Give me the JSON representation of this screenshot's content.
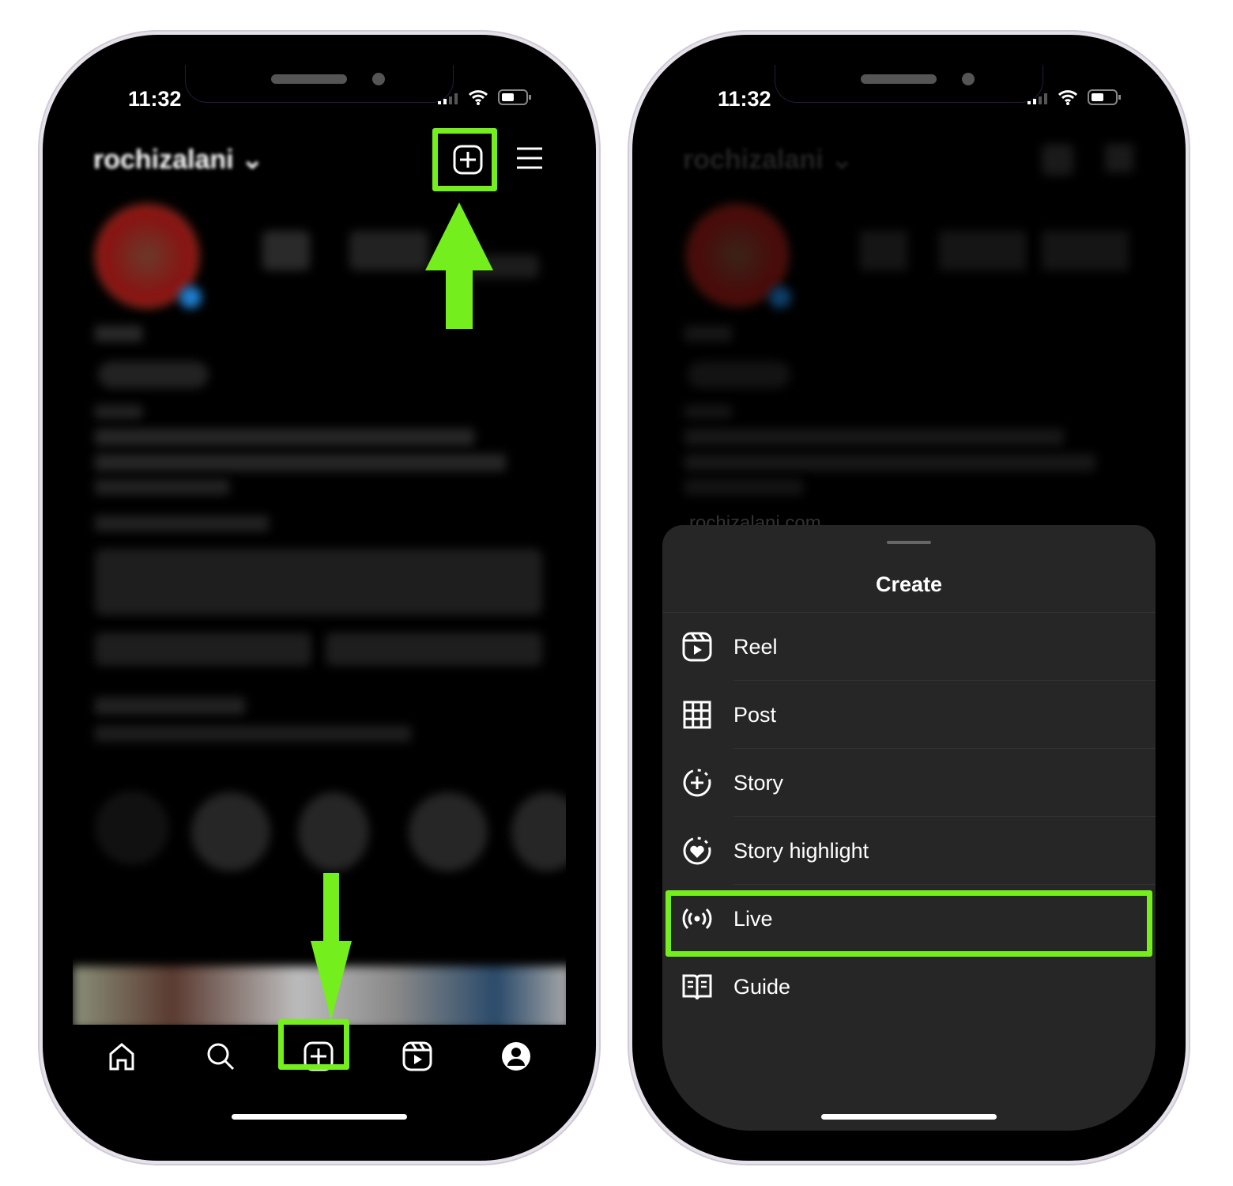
{
  "left_phone": {
    "status_time": "11:32",
    "username": "rochizalani",
    "highlight_color": "#74ee1c",
    "nav": [
      "home-icon",
      "search-icon",
      "create-icon",
      "reels-icon",
      "profile-icon"
    ]
  },
  "right_phone": {
    "status_time": "11:32",
    "username": "rochizalani",
    "link_text": "rochizalani.com",
    "sheet": {
      "title": "Create",
      "items": [
        {
          "label": "Reel",
          "icon": "reel-icon"
        },
        {
          "label": "Post",
          "icon": "grid-icon"
        },
        {
          "label": "Story",
          "icon": "story-add-icon"
        },
        {
          "label": "Story highlight",
          "icon": "story-highlight-icon"
        },
        {
          "label": "Live",
          "icon": "live-icon",
          "highlighted": true
        },
        {
          "label": "Guide",
          "icon": "guide-icon"
        }
      ]
    }
  }
}
